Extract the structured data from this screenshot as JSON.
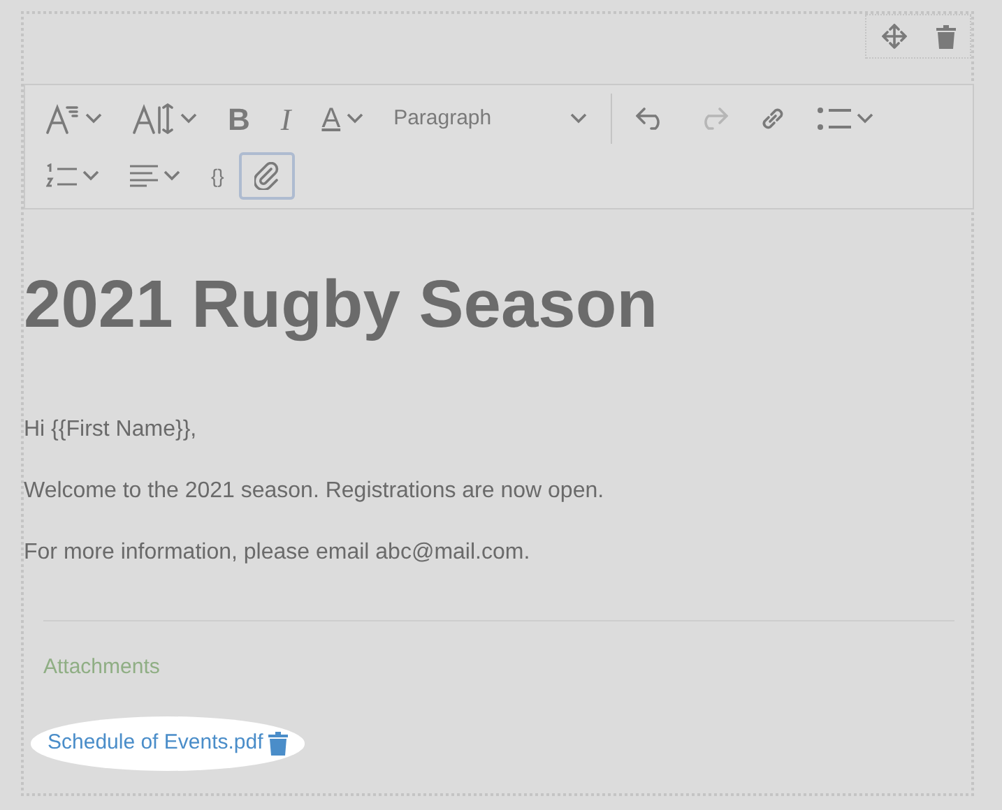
{
  "block_actions": [
    {
      "kind": "move"
    },
    {
      "kind": "delete"
    }
  ],
  "toolbar": [
    {
      "kind": "fontstyle",
      "dropdown": true
    },
    {
      "kind": "fontsize",
      "dropdown": true
    },
    {
      "kind": "bold",
      "label": "B"
    },
    {
      "kind": "italic",
      "label": "I"
    },
    {
      "kind": "color",
      "label": "A",
      "dropdown": true
    },
    {
      "kind": "select",
      "label": "Paragraph",
      "dropdown": true
    },
    {
      "kind": "divider"
    },
    {
      "kind": "undo",
      "disabled": false
    },
    {
      "kind": "redo",
      "disabled": true
    },
    {
      "kind": "link"
    },
    {
      "kind": "bullets",
      "dropdown": true
    },
    {
      "kind": "numbers",
      "dropdown": true
    },
    {
      "kind": "align",
      "dropdown": true
    },
    {
      "kind": "code",
      "label": "{}"
    },
    {
      "kind": "attach",
      "selected": true
    }
  ],
  "heading": "2021 Rugby Season",
  "paragraphs": [
    "Hi {{First Name}},",
    "Welcome to the 2021 season. Registrations are now open.",
    "For more information, please email abc@mail.com."
  ],
  "attachments": {
    "title": "Attachments",
    "files": [
      {
        "name": "Schedule of Events.pdf",
        "highlighted": true
      }
    ]
  }
}
